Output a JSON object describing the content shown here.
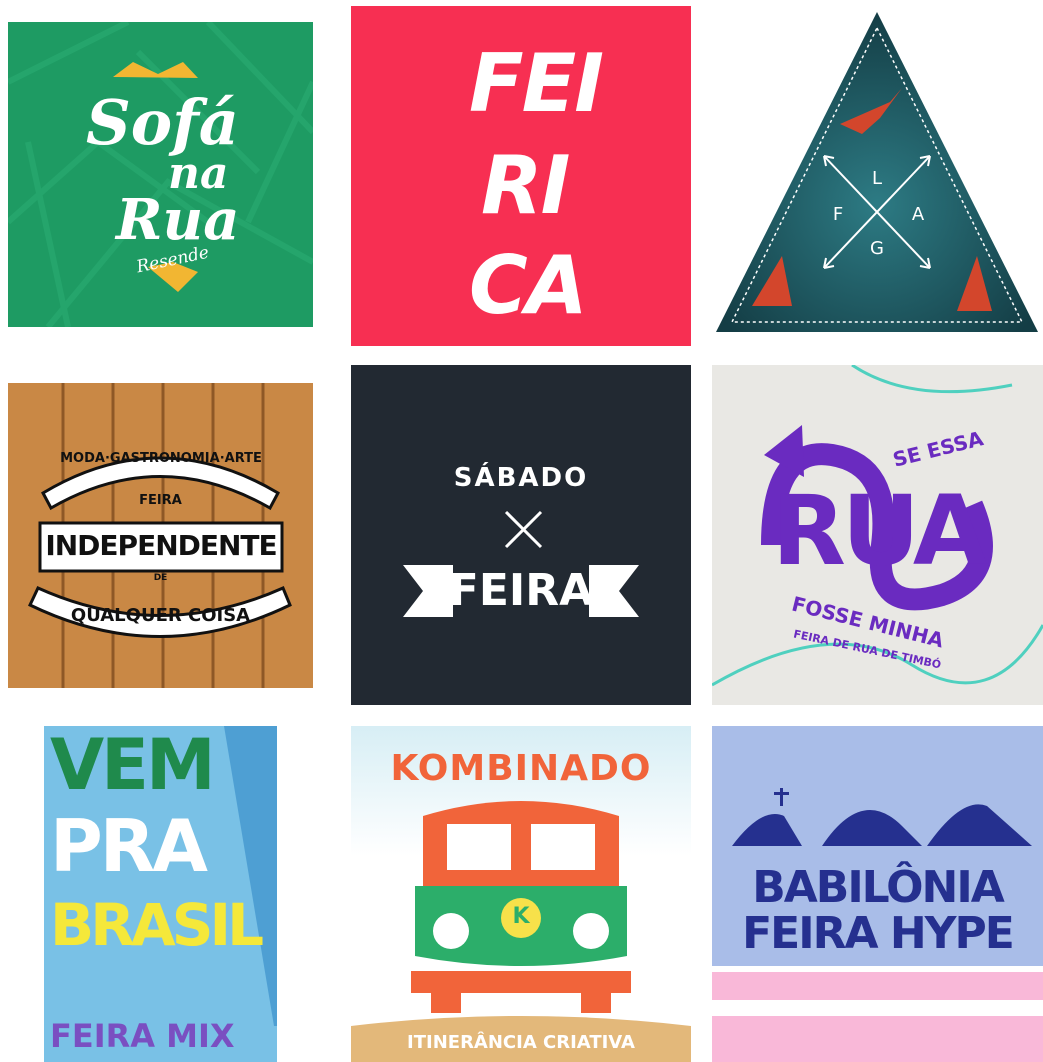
{
  "tiles": {
    "sofa": {
      "line1": "Sofá",
      "line2": "na",
      "line3": "Rua",
      "line4": "Resende"
    },
    "ferica": {
      "line1": "FEI",
      "line2": "RI",
      "line3": "CA"
    },
    "flag": {
      "top": "L",
      "left": "F",
      "right": "A",
      "bottom": "G"
    },
    "independente": {
      "arc_top": "MODA·GASTRONOMIA·ARTE",
      "small_top": "FEIRA",
      "main": "INDEPENDENTE",
      "small_mid": "DE",
      "arc_bottom": "QUALQUER COISA"
    },
    "sabado": {
      "top": "SÁBADO",
      "banner": "FEIRA"
    },
    "seessa": {
      "top": "SE ESSA",
      "main": "RUA",
      "bottom": "FOSSE MINHA",
      "sub": "FEIRA DE RUA DE TIMBÓ"
    },
    "vempra": {
      "line1": "VEM",
      "line2": "PRA",
      "line3": "BRASIL",
      "line4": "FEIRA MIX"
    },
    "kombinado": {
      "title": "KOMBINADO",
      "badge": "K",
      "footer": "ITINERÂNCIA CRIATIVA"
    },
    "babilonia": {
      "line1": "BABILÔNIA",
      "line2": "FEIRA HYPE"
    }
  },
  "colors": {
    "sofa_bg": "#1e9b63",
    "sofa_accent": "#f2b632",
    "ferica_bg": "#f72f52",
    "flag_bg": "#1d5b63",
    "flag_bird": "#d3462c",
    "wood": "#c98845",
    "sabado_bg": "#222932",
    "rua_purple": "#6a2bc0",
    "rua_teal": "#4fd0bf",
    "vem_green": "#1f8a4c",
    "vem_yellow": "#f5e83a",
    "vem_purple": "#7a4fc1",
    "kombi_orange": "#f1643a",
    "kombi_green": "#2cae6a",
    "babilonia_blue": "#25308f",
    "babilonia_sky": "#a9bde8",
    "babilonia_pink": "#f9b8d8"
  }
}
